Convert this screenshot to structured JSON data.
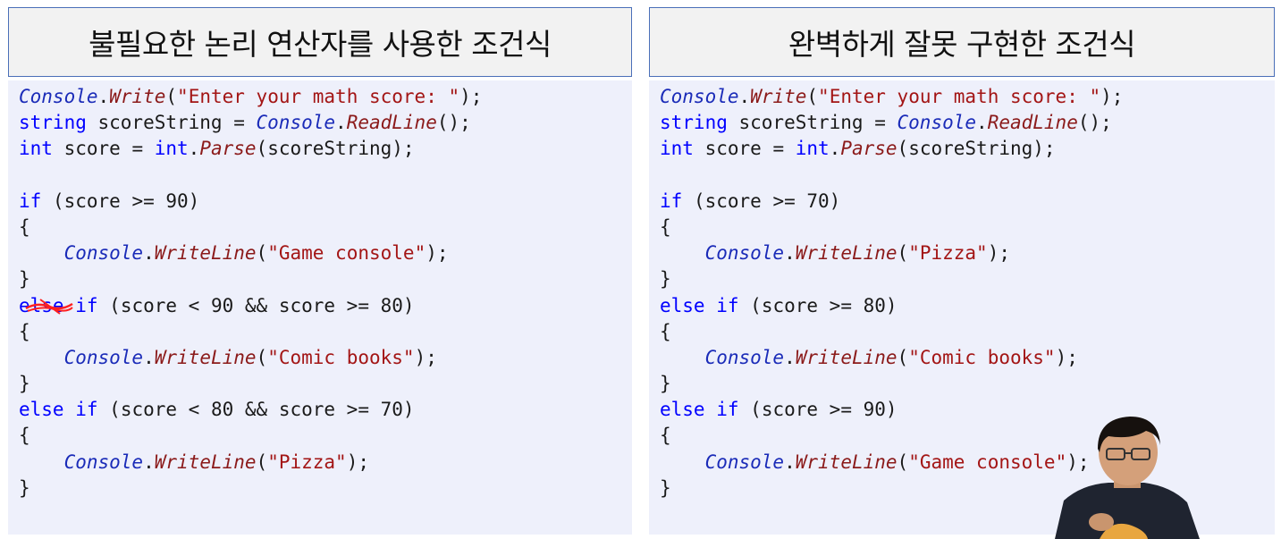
{
  "left_panel": {
    "title": "불필요한 논리 연산자를 사용한 조건식",
    "lines": [
      [
        {
          "t": "Console",
          "c": "cls"
        },
        {
          "t": "."
        },
        {
          "t": "Write",
          "c": "mth"
        },
        {
          "t": "("
        },
        {
          "t": "\"Enter your math score: \"",
          "c": "str"
        },
        {
          "t": ");"
        }
      ],
      [
        {
          "t": "string",
          "c": "kw"
        },
        {
          "t": " scoreString = "
        },
        {
          "t": "Console",
          "c": "cls"
        },
        {
          "t": "."
        },
        {
          "t": "ReadLine",
          "c": "mth"
        },
        {
          "t": "();"
        }
      ],
      [
        {
          "t": "int",
          "c": "kw"
        },
        {
          "t": " score = "
        },
        {
          "t": "int",
          "c": "kw"
        },
        {
          "t": "."
        },
        {
          "t": "Parse",
          "c": "mth"
        },
        {
          "t": "(scoreString);"
        }
      ],
      [],
      [
        {
          "t": "if",
          "c": "kw"
        },
        {
          "t": " (score >= 90)"
        }
      ],
      [
        {
          "t": "{"
        }
      ],
      [
        {
          "t": "    "
        },
        {
          "t": "Console",
          "c": "cls"
        },
        {
          "t": "."
        },
        {
          "t": "WriteLine",
          "c": "mth"
        },
        {
          "t": "("
        },
        {
          "t": "\"Game console\"",
          "c": "str"
        },
        {
          "t": ");"
        }
      ],
      [
        {
          "t": "}"
        }
      ],
      [
        {
          "t": "else",
          "c": "kw"
        },
        {
          "t": " "
        },
        {
          "t": "if",
          "c": "kw"
        },
        {
          "t": " (score < 90 && score >= 80)"
        }
      ],
      [
        {
          "t": "{"
        }
      ],
      [
        {
          "t": "    "
        },
        {
          "t": "Console",
          "c": "cls"
        },
        {
          "t": "."
        },
        {
          "t": "WriteLine",
          "c": "mth"
        },
        {
          "t": "("
        },
        {
          "t": "\"Comic books\"",
          "c": "str"
        },
        {
          "t": ");"
        }
      ],
      [
        {
          "t": "}"
        }
      ],
      [
        {
          "t": "else",
          "c": "kw"
        },
        {
          "t": " "
        },
        {
          "t": "if",
          "c": "kw"
        },
        {
          "t": " (score < 80 && score >= 70)"
        }
      ],
      [
        {
          "t": "{"
        }
      ],
      [
        {
          "t": "    "
        },
        {
          "t": "Console",
          "c": "cls"
        },
        {
          "t": "."
        },
        {
          "t": "WriteLine",
          "c": "mth"
        },
        {
          "t": "("
        },
        {
          "t": "\"Pizza\"",
          "c": "str"
        },
        {
          "t": ");"
        }
      ],
      [
        {
          "t": "}"
        }
      ]
    ]
  },
  "right_panel": {
    "title": "완벽하게 잘못 구현한 조건식",
    "lines": [
      [
        {
          "t": "Console",
          "c": "cls"
        },
        {
          "t": "."
        },
        {
          "t": "Write",
          "c": "mth"
        },
        {
          "t": "("
        },
        {
          "t": "\"Enter your math score: \"",
          "c": "str"
        },
        {
          "t": ");"
        }
      ],
      [
        {
          "t": "string",
          "c": "kw"
        },
        {
          "t": " scoreString = "
        },
        {
          "t": "Console",
          "c": "cls"
        },
        {
          "t": "."
        },
        {
          "t": "ReadLine",
          "c": "mth"
        },
        {
          "t": "();"
        }
      ],
      [
        {
          "t": "int",
          "c": "kw"
        },
        {
          "t": " score = "
        },
        {
          "t": "int",
          "c": "kw"
        },
        {
          "t": "."
        },
        {
          "t": "Parse",
          "c": "mth"
        },
        {
          "t": "(scoreString);"
        }
      ],
      [],
      [
        {
          "t": "if",
          "c": "kw"
        },
        {
          "t": " (score >= 70)"
        }
      ],
      [
        {
          "t": "{"
        }
      ],
      [
        {
          "t": "    "
        },
        {
          "t": "Console",
          "c": "cls"
        },
        {
          "t": "."
        },
        {
          "t": "WriteLine",
          "c": "mth"
        },
        {
          "t": "("
        },
        {
          "t": "\"Pizza\"",
          "c": "str"
        },
        {
          "t": ");"
        }
      ],
      [
        {
          "t": "}"
        }
      ],
      [
        {
          "t": "else",
          "c": "kw"
        },
        {
          "t": " "
        },
        {
          "t": "if",
          "c": "kw"
        },
        {
          "t": " (score >= 80)"
        }
      ],
      [
        {
          "t": "{"
        }
      ],
      [
        {
          "t": "    "
        },
        {
          "t": "Console",
          "c": "cls"
        },
        {
          "t": "."
        },
        {
          "t": "WriteLine",
          "c": "mth"
        },
        {
          "t": "("
        },
        {
          "t": "\"Comic books\"",
          "c": "str"
        },
        {
          "t": ");"
        }
      ],
      [
        {
          "t": "}"
        }
      ],
      [
        {
          "t": "else",
          "c": "kw"
        },
        {
          "t": " "
        },
        {
          "t": "if",
          "c": "kw"
        },
        {
          "t": " (score >= 90)"
        }
      ],
      [
        {
          "t": "{"
        }
      ],
      [
        {
          "t": "    "
        },
        {
          "t": "Console",
          "c": "cls"
        },
        {
          "t": "."
        },
        {
          "t": "WriteLine",
          "c": "mth"
        },
        {
          "t": "("
        },
        {
          "t": "\"Game console\"",
          "c": "str"
        },
        {
          "t": ");"
        }
      ],
      [
        {
          "t": "}"
        }
      ]
    ]
  },
  "colors": {
    "keyword": "#0000ff",
    "class": "#1a2bb8",
    "method": "#8b1a1a",
    "string": "#a31515",
    "code_bg": "#eef0fb",
    "header_bg": "#f2f2f2",
    "header_border": "#4a6fb8",
    "strike": "#ff2020"
  },
  "annotations": {
    "strikethrough_on": "left_panel.lines.8 else"
  },
  "presenter": {
    "icon": "person-figure"
  }
}
